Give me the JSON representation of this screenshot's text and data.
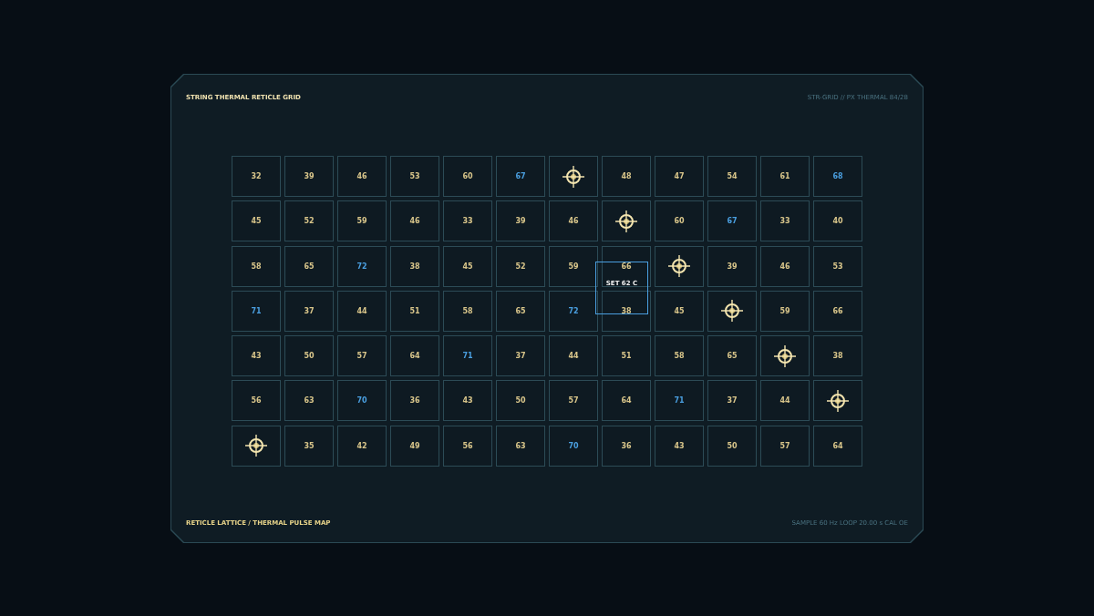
{
  "panel": {
    "title": "STRING THERMAL RETICLE GRID",
    "code": "STR-GRID // PX THERMAL 84/28"
  },
  "grid": {
    "rows": [
      [
        {
          "kind": "value",
          "text": "32",
          "color": "#d8c58a"
        },
        {
          "kind": "value",
          "text": "39",
          "color": "#d8c58a"
        },
        {
          "kind": "value",
          "text": "46",
          "color": "#d8c58a"
        },
        {
          "kind": "value",
          "text": "53",
          "color": "#d8c58a"
        },
        {
          "kind": "value",
          "text": "60",
          "color": "#d8c58a"
        },
        {
          "kind": "value",
          "text": "67",
          "color": "#4a9fe0"
        },
        {
          "kind": "reticle"
        },
        {
          "kind": "value",
          "text": "48",
          "color": "#d8c58a"
        },
        {
          "kind": "value",
          "text": "47",
          "color": "#d8c58a"
        },
        {
          "kind": "value",
          "text": "54",
          "color": "#d8c58a"
        },
        {
          "kind": "value",
          "text": "61",
          "color": "#d8c58a"
        },
        {
          "kind": "value",
          "text": "68",
          "color": "#4a9fe0"
        }
      ],
      [
        {
          "kind": "value",
          "text": "45",
          "color": "#d8c58a"
        },
        {
          "kind": "value",
          "text": "52",
          "color": "#d8c58a"
        },
        {
          "kind": "value",
          "text": "59",
          "color": "#d8c58a"
        },
        {
          "kind": "value",
          "text": "46",
          "color": "#d8c58a"
        },
        {
          "kind": "value",
          "text": "33",
          "color": "#d8c58a"
        },
        {
          "kind": "value",
          "text": "39",
          "color": "#d8c58a"
        },
        {
          "kind": "value",
          "text": "46",
          "color": "#d8c58a"
        },
        {
          "kind": "reticle"
        },
        {
          "kind": "value",
          "text": "60",
          "color": "#d8c58a"
        },
        {
          "kind": "value",
          "text": "67",
          "color": "#4a9fe0"
        },
        {
          "kind": "value",
          "text": "33",
          "color": "#d8c58a"
        },
        {
          "kind": "value",
          "text": "40",
          "color": "#d8c58a"
        }
      ],
      [
        {
          "kind": "value",
          "text": "58",
          "color": "#d8c58a"
        },
        {
          "kind": "value",
          "text": "65",
          "color": "#d8c58a"
        },
        {
          "kind": "value",
          "text": "72",
          "color": "#4a9fe0"
        },
        {
          "kind": "value",
          "text": "38",
          "color": "#d8c58a"
        },
        {
          "kind": "value",
          "text": "45",
          "color": "#d8c58a"
        },
        {
          "kind": "value",
          "text": "52",
          "color": "#d8c58a"
        },
        {
          "kind": "value",
          "text": "59",
          "color": "#d8c58a"
        },
        {
          "kind": "value",
          "text": "66",
          "color": "#d8c58a"
        },
        {
          "kind": "reticle"
        },
        {
          "kind": "value",
          "text": "39",
          "color": "#d8c58a"
        },
        {
          "kind": "value",
          "text": "46",
          "color": "#d8c58a"
        },
        {
          "kind": "value",
          "text": "53",
          "color": "#d8c58a"
        }
      ],
      [
        {
          "kind": "value",
          "text": "71",
          "color": "#4a9fe0"
        },
        {
          "kind": "value",
          "text": "37",
          "color": "#d8c58a"
        },
        {
          "kind": "value",
          "text": "44",
          "color": "#d8c58a"
        },
        {
          "kind": "value",
          "text": "51",
          "color": "#d8c58a"
        },
        {
          "kind": "value",
          "text": "58",
          "color": "#d8c58a"
        },
        {
          "kind": "value",
          "text": "65",
          "color": "#d8c58a"
        },
        {
          "kind": "value",
          "text": "72",
          "color": "#4a9fe0"
        },
        {
          "kind": "value",
          "text": "38",
          "color": "#d8c58a"
        },
        {
          "kind": "value",
          "text": "45",
          "color": "#d8c58a"
        },
        {
          "kind": "reticle"
        },
        {
          "kind": "value",
          "text": "59",
          "color": "#d8c58a"
        },
        {
          "kind": "value",
          "text": "66",
          "color": "#d8c58a"
        }
      ],
      [
        {
          "kind": "value",
          "text": "43",
          "color": "#d8c58a"
        },
        {
          "kind": "value",
          "text": "50",
          "color": "#d8c58a"
        },
        {
          "kind": "value",
          "text": "57",
          "color": "#d8c58a"
        },
        {
          "kind": "value",
          "text": "64",
          "color": "#d8c58a"
        },
        {
          "kind": "value",
          "text": "71",
          "color": "#4a9fe0"
        },
        {
          "kind": "value",
          "text": "37",
          "color": "#d8c58a"
        },
        {
          "kind": "value",
          "text": "44",
          "color": "#d8c58a"
        },
        {
          "kind": "value",
          "text": "51",
          "color": "#d8c58a"
        },
        {
          "kind": "value",
          "text": "58",
          "color": "#d8c58a"
        },
        {
          "kind": "value",
          "text": "65",
          "color": "#d8c58a"
        },
        {
          "kind": "reticle"
        },
        {
          "kind": "value",
          "text": "38",
          "color": "#d8c58a"
        }
      ],
      [
        {
          "kind": "value",
          "text": "56",
          "color": "#d8c58a"
        },
        {
          "kind": "value",
          "text": "63",
          "color": "#d8c58a"
        },
        {
          "kind": "value",
          "text": "70",
          "color": "#4a9fe0"
        },
        {
          "kind": "value",
          "text": "36",
          "color": "#d8c58a"
        },
        {
          "kind": "value",
          "text": "43",
          "color": "#d8c58a"
        },
        {
          "kind": "value",
          "text": "50",
          "color": "#d8c58a"
        },
        {
          "kind": "value",
          "text": "57",
          "color": "#d8c58a"
        },
        {
          "kind": "value",
          "text": "64",
          "color": "#d8c58a"
        },
        {
          "kind": "value",
          "text": "71",
          "color": "#4a9fe0"
        },
        {
          "kind": "value",
          "text": "37",
          "color": "#d8c58a"
        },
        {
          "kind": "value",
          "text": "44",
          "color": "#d8c58a"
        },
        {
          "kind": "reticle"
        }
      ],
      [
        {
          "kind": "reticle"
        },
        {
          "kind": "value",
          "text": "35",
          "color": "#d8c58a"
        },
        {
          "kind": "value",
          "text": "42",
          "color": "#d8c58a"
        },
        {
          "kind": "value",
          "text": "49",
          "color": "#d8c58a"
        },
        {
          "kind": "value",
          "text": "56",
          "color": "#d8c58a"
        },
        {
          "kind": "value",
          "text": "63",
          "color": "#d8c58a"
        },
        {
          "kind": "value",
          "text": "70",
          "color": "#4a9fe0"
        },
        {
          "kind": "value",
          "text": "36",
          "color": "#d8c58a"
        },
        {
          "kind": "value",
          "text": "43",
          "color": "#d8c58a"
        },
        {
          "kind": "value",
          "text": "50",
          "color": "#d8c58a"
        },
        {
          "kind": "value",
          "text": "57",
          "color": "#d8c58a"
        },
        {
          "kind": "value",
          "text": "64",
          "color": "#d8c58a"
        }
      ]
    ],
    "marker": {
      "label": "SET 62 C"
    }
  },
  "footer": {
    "left": "RETICLE LATTICE / THERMAL PULSE MAP",
    "right": "SAMPLE 60 Hz  LOOP 20.00 s  CAL OE"
  }
}
